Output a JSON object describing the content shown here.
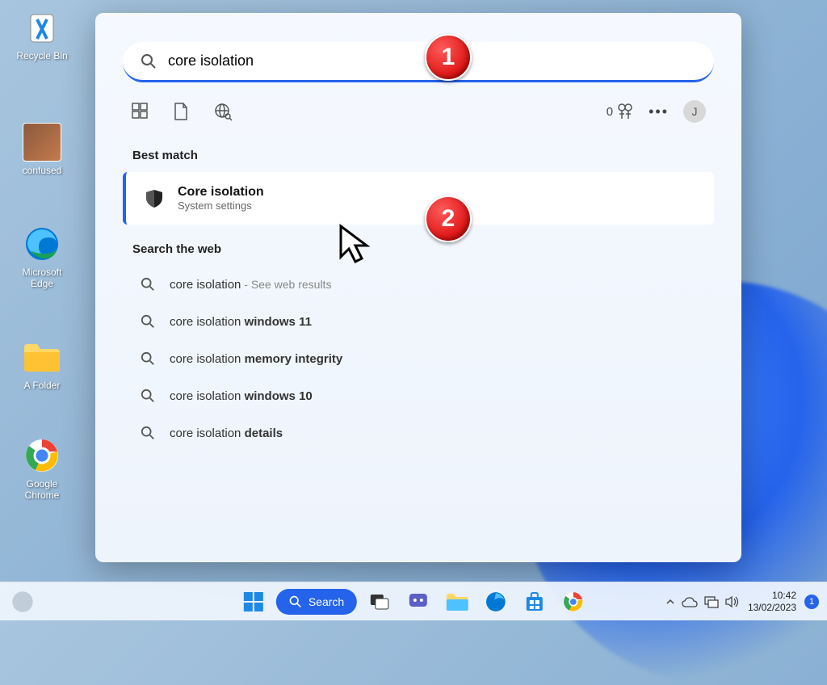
{
  "desktop": {
    "icons": [
      {
        "label": "Recycle Bin",
        "kind": "recycle"
      },
      {
        "label": "confused",
        "kind": "photo"
      },
      {
        "label": "Microsoft Edge",
        "kind": "edge"
      },
      {
        "label": "A Folder",
        "kind": "folder"
      },
      {
        "label": "Google Chrome",
        "kind": "chrome"
      }
    ]
  },
  "search": {
    "query": "core isolation",
    "best_match_heading": "Best match",
    "best_match_title": "Core isolation",
    "best_match_sub": "System settings",
    "web_heading": "Search the web",
    "rewards_count": "0",
    "avatar_initial": "J",
    "web_results": [
      {
        "prefix": "core isolation",
        "bold": "",
        "suffix": " - See web results"
      },
      {
        "prefix": "core isolation ",
        "bold": "windows 11",
        "suffix": ""
      },
      {
        "prefix": "core isolation ",
        "bold": "memory integrity",
        "suffix": ""
      },
      {
        "prefix": "core isolation ",
        "bold": "windows 10",
        "suffix": ""
      },
      {
        "prefix": "core isolation ",
        "bold": "details",
        "suffix": ""
      }
    ]
  },
  "annotations": {
    "badge1": "1",
    "badge2": "2"
  },
  "taskbar": {
    "search_label": "Search",
    "time": "10:42",
    "date": "13/02/2023",
    "notif_count": "1"
  }
}
